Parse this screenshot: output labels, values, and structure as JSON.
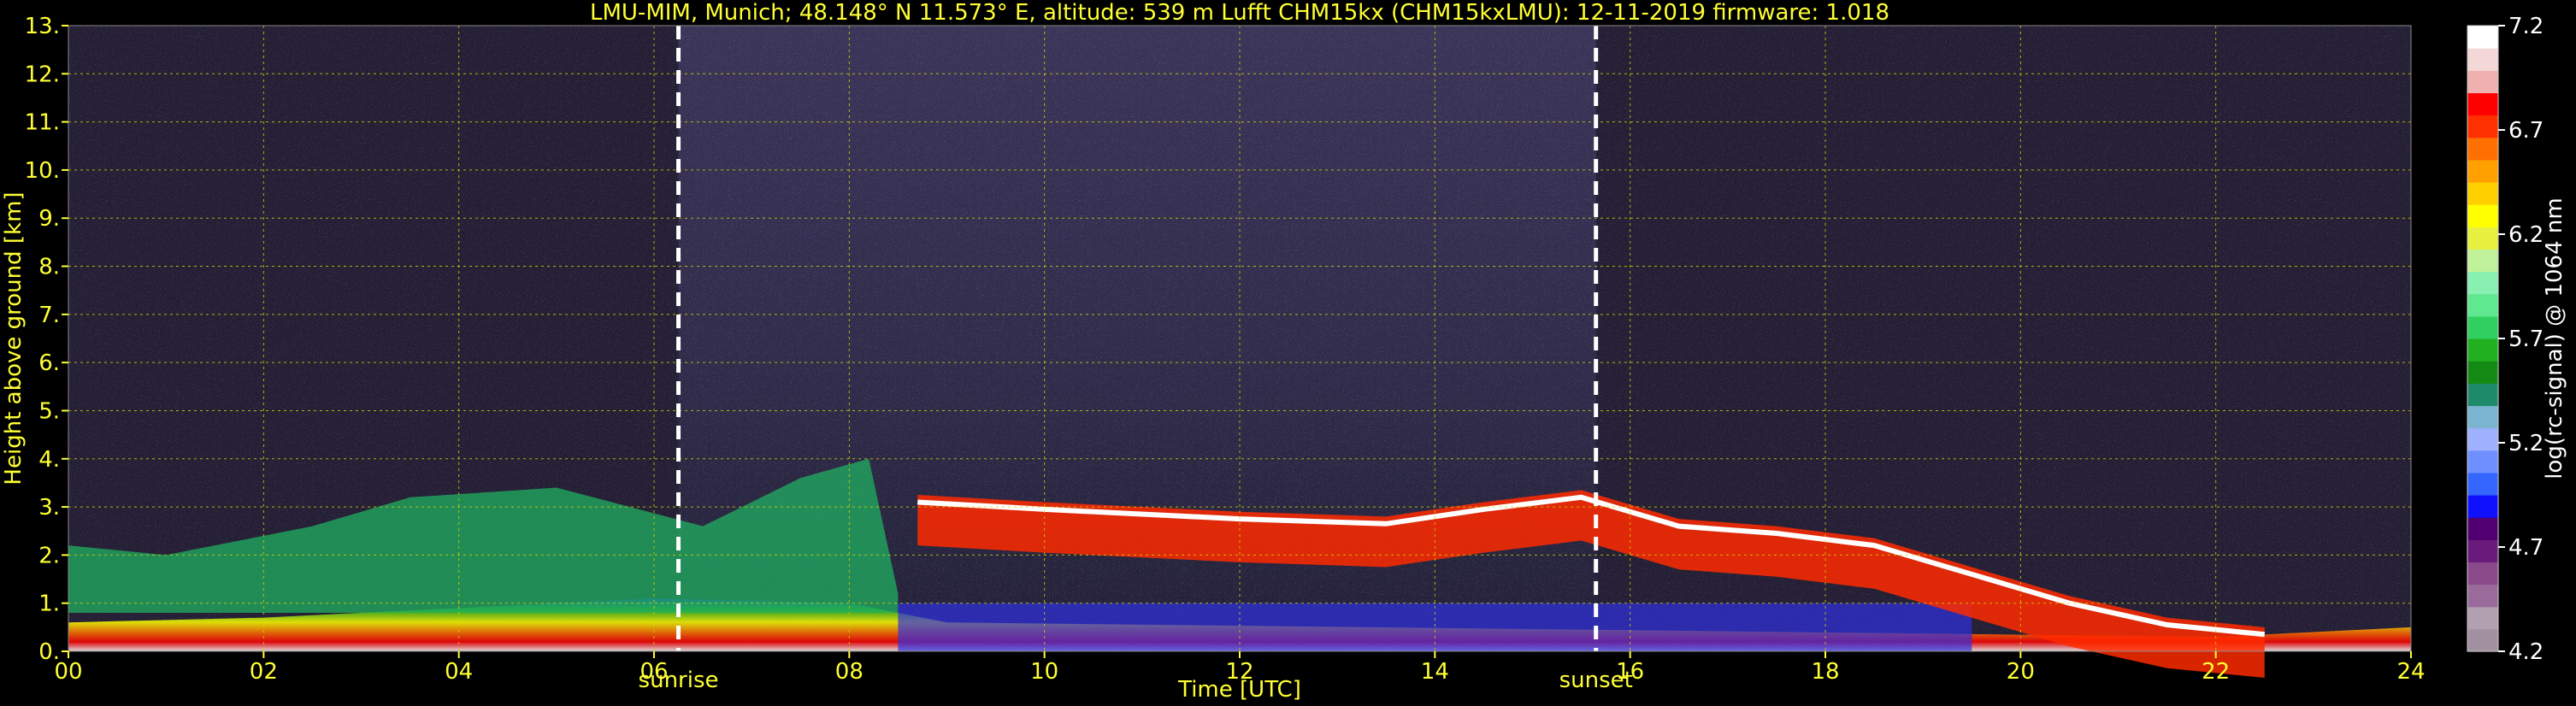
{
  "chart_data": {
    "type": "heatmap",
    "title": "LMU-MIM, Munich; 48.148° N 11.573° E, altitude: 539 m    Lufft CHM15kx (CHM15kxLMU): 12-11-2019    firmware: 1.018",
    "xlabel": "Time [UTC]",
    "ylabel": "Height above ground [km]",
    "xlim": [
      0,
      24
    ],
    "ylim": [
      0,
      13
    ],
    "x_ticks": [
      "00",
      "02",
      "04",
      "06",
      "08",
      "10",
      "12",
      "14",
      "16",
      "18",
      "20",
      "22",
      "24"
    ],
    "y_ticks": [
      "0.",
      "1.",
      "2.",
      "3.",
      "4.",
      "5.",
      "6.",
      "7.",
      "8.",
      "9.",
      "10.",
      "11.",
      "12.",
      "13."
    ],
    "grid": true,
    "markers": [
      {
        "label": "sunrise",
        "time": 6.25
      },
      {
        "label": "sunset",
        "time": 15.65
      }
    ],
    "colorbar": {
      "label": "log(rc-signal) @ 1064 nm",
      "min": 4.2,
      "max": 7.2,
      "ticks": [
        "7.2",
        "6.7",
        "6.2",
        "5.7",
        "5.2",
        "4.7",
        "4.2"
      ],
      "colors": [
        "#a090a0",
        "#b0a0b0",
        "#9a6a9a",
        "#8a4a8a",
        "#6a1a7a",
        "#500070",
        "#1010ff",
        "#3366ff",
        "#6f8fff",
        "#9fb0ff",
        "#7ab4d0",
        "#1e8a6a",
        "#138a13",
        "#20b020",
        "#30d060",
        "#60e890",
        "#88f0b0",
        "#bff29a",
        "#e8f040",
        "#ffff00",
        "#ffd000",
        "#ffa000",
        "#ff7000",
        "#ff3000",
        "#ff0000",
        "#f0b0b0",
        "#f4d8d8",
        "#ffffff"
      ]
    },
    "cloud_base_km": [
      {
        "t": 8.7,
        "h": 3.1
      },
      {
        "t": 10.0,
        "h": 2.95
      },
      {
        "t": 12.0,
        "h": 2.75
      },
      {
        "t": 13.5,
        "h": 2.65
      },
      {
        "t": 14.5,
        "h": 2.95
      },
      {
        "t": 15.5,
        "h": 3.2
      },
      {
        "t": 16.5,
        "h": 2.6
      },
      {
        "t": 17.5,
        "h": 2.45
      },
      {
        "t": 18.5,
        "h": 2.2
      },
      {
        "t": 19.5,
        "h": 1.6
      },
      {
        "t": 20.5,
        "h": 1.0
      },
      {
        "t": 21.5,
        "h": 0.55
      },
      {
        "t": 22.5,
        "h": 0.35
      }
    ]
  }
}
